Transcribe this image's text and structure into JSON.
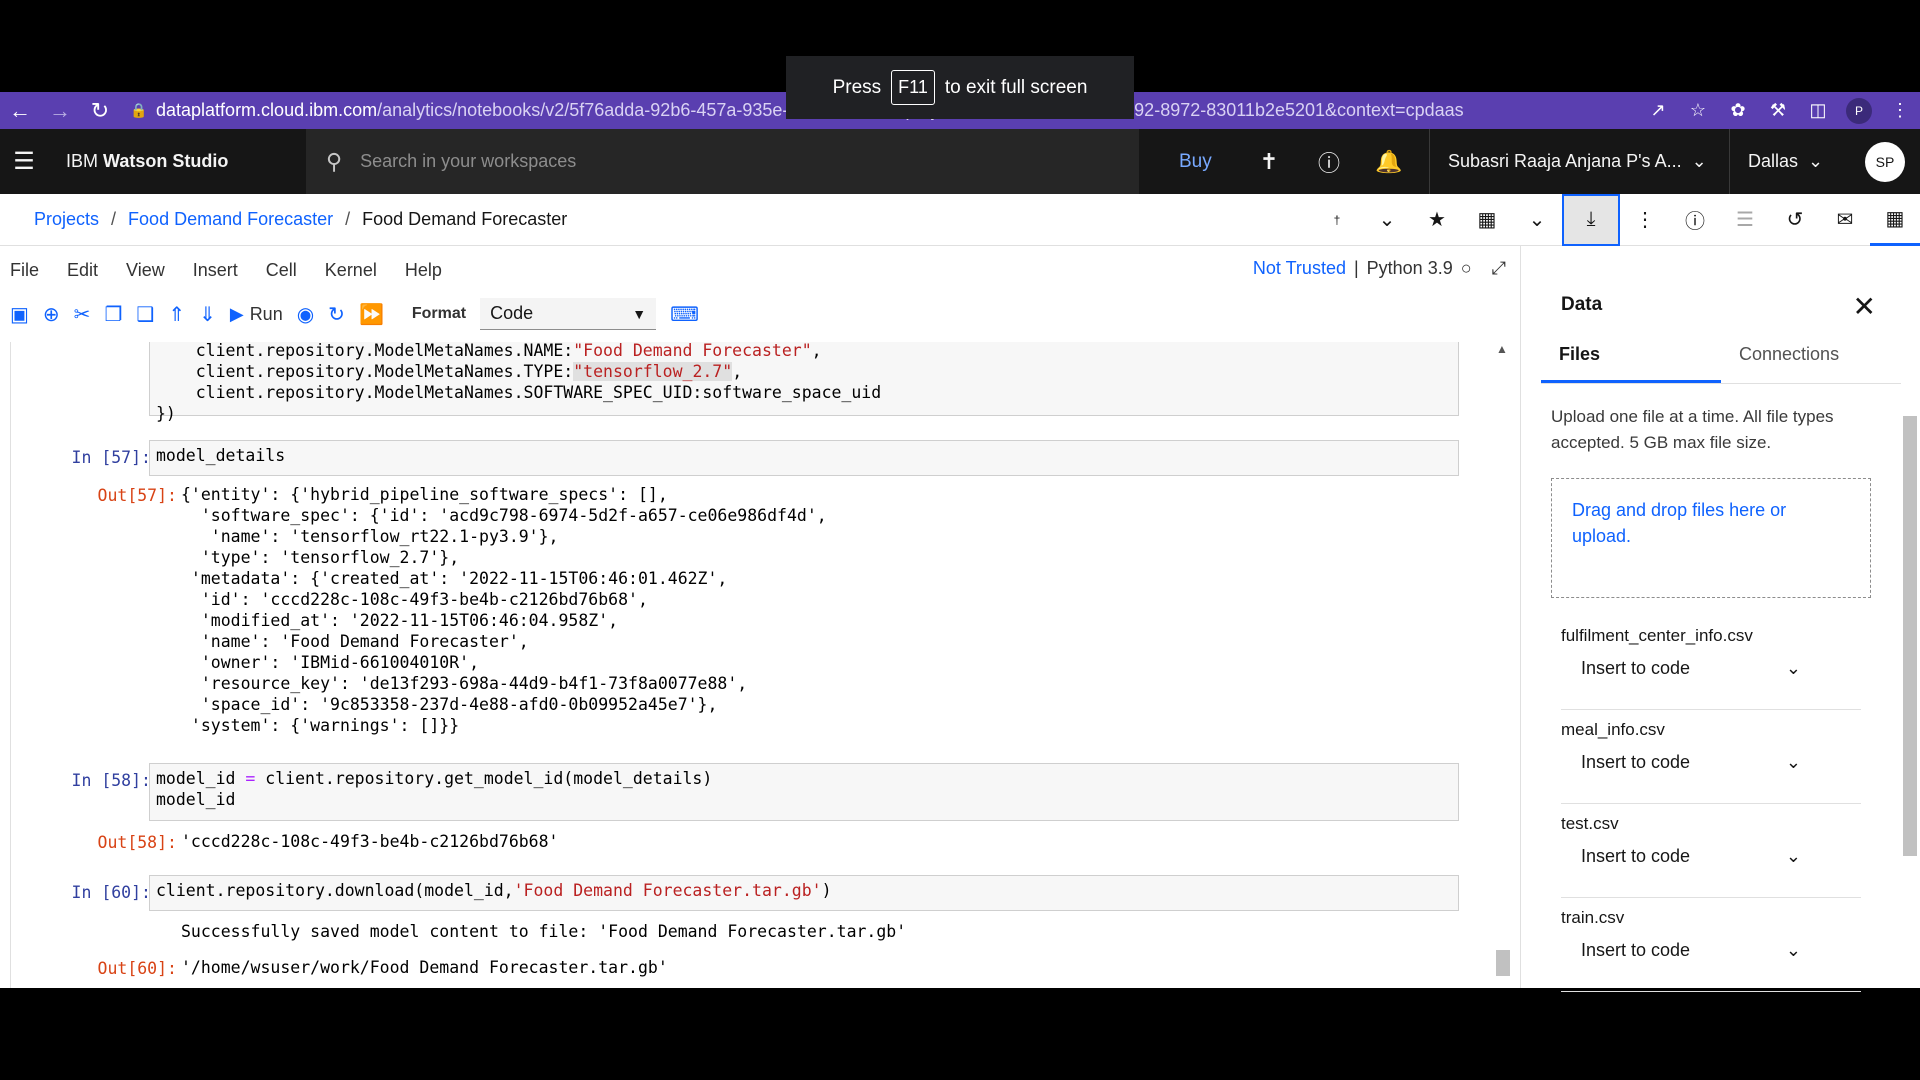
{
  "toast": {
    "press": "Press",
    "key": "F11",
    "rest": "to exit full screen"
  },
  "browser": {
    "url_host": "dataplatform.cloud.ibm.com",
    "url_path": "/analytics/notebooks/v2/5f76adda-92b6-457a-935e-480dedb85...&projectid=9c1a15ce-0764-4792-8972-83011b2e5201&context=cpdaas",
    "profile": "P"
  },
  "header": {
    "brand_prefix": "IBM",
    "brand_name": "Watson Studio",
    "search_placeholder": "Search in your workspaces",
    "buy": "Buy",
    "account": "Subasri Raaja Anjana P's A...",
    "region": "Dallas",
    "avatar": "SP"
  },
  "breadcrumb": {
    "projects": "Projects",
    "project": "Food Demand Forecaster",
    "current": "Food Demand Forecaster"
  },
  "menu": {
    "file": "File",
    "edit": "Edit",
    "view": "View",
    "insert": "Insert",
    "cell": "Cell",
    "kernel": "Kernel",
    "help": "Help"
  },
  "kernel": {
    "trust": "Not Trusted",
    "name": "Python 3.9"
  },
  "toolbar": {
    "run": "Run",
    "format_label": "Format",
    "format_value": "Code"
  },
  "cells": {
    "c0": {
      "l1a": "    client.repository.ModelMetaNames.NAME:",
      "l1s": "\"Food Demand Forecaster\"",
      "l1b": ",",
      "l2a": "    client.repository.ModelMetaNames.TYPE:",
      "l2s": "\"tensorflow_2.7\"",
      "l2b": ",",
      "l3": "    client.repository.ModelMetaNames.SOFTWARE_SPEC_UID:software_space_uid",
      "l4": "})"
    },
    "c57": {
      "in_prompt": "In [57]:",
      "code": "model_details",
      "out_prompt": "Out[57]:",
      "output": "{'entity': {'hybrid_pipeline_software_specs': [],\n  'software_spec': {'id': 'acd9c798-6974-5d2f-a657-ce06e986df4d',\n   'name': 'tensorflow_rt22.1-py3.9'},\n  'type': 'tensorflow_2.7'},\n 'metadata': {'created_at': '2022-11-15T06:46:01.462Z',\n  'id': 'cccd228c-108c-49f3-be4b-c2126bd76b68',\n  'modified_at': '2022-11-15T06:46:04.958Z',\n  'name': 'Food Demand Forecaster',\n  'owner': 'IBMid-661004010R',\n  'resource_key': 'de13f293-698a-44d9-b4f1-73f8a0077e88',\n  'space_id': '9c853358-237d-4e88-afd0-0b09952a45e7'},\n 'system': {'warnings': []}}"
    },
    "c58": {
      "in_prompt": "In [58]:",
      "code_a": "model_id ",
      "code_op": "=",
      "code_b": " client.repository.get_model_id(model_details)",
      "code_2": "model_id",
      "out_prompt": "Out[58]:",
      "output": "'cccd228c-108c-49f3-be4b-c2126bd76b68'"
    },
    "c60": {
      "in_prompt": "In [60]:",
      "code_a": "client.repository.download(model_id,",
      "code_s": "'Food Demand Forecaster.tar.gb'",
      "code_b": ")",
      "stdout": "Successfully saved model content to file: 'Food Demand Forecaster.tar.gb'",
      "out_prompt": "Out[60]:",
      "output": "'/home/wsuser/work/Food Demand Forecaster.tar.gb'"
    }
  },
  "panel": {
    "title": "Data",
    "tab_files": "Files",
    "tab_connections": "Connections",
    "description": "Upload one file at a time. All file types accepted. 5 GB max file size.",
    "drop_text": "Drag and drop files here or upload.",
    "files": [
      {
        "name": "fulfilment_center_info.csv",
        "action": "Insert to code"
      },
      {
        "name": "meal_info.csv",
        "action": "Insert to code"
      },
      {
        "name": "test.csv",
        "action": "Insert to code"
      },
      {
        "name": "train.csv",
        "action": "Insert to code"
      }
    ]
  }
}
